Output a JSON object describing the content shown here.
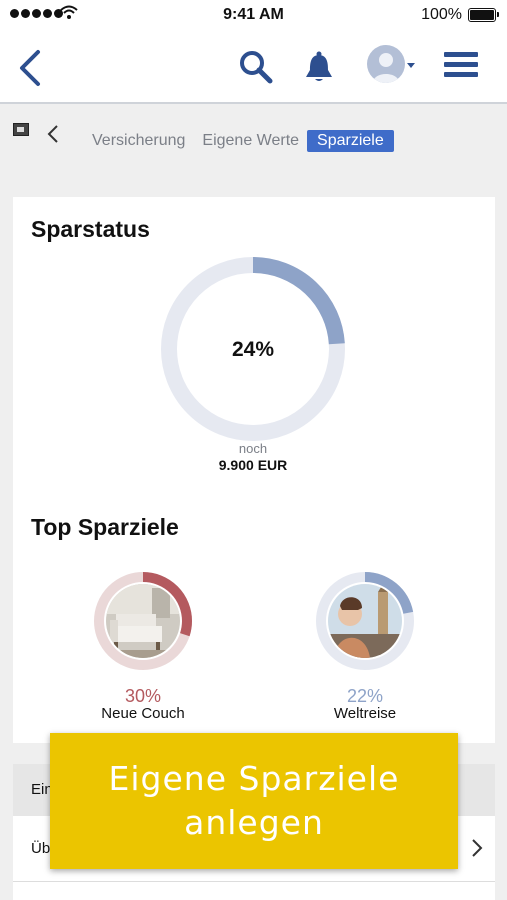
{
  "status_bar": {
    "time": "9:41 AM",
    "battery": "100%"
  },
  "nav": {
    "back_icon": "chevron-left-icon",
    "search_icon": "search-icon",
    "bell_icon": "bell-icon",
    "avatar_icon": "user-avatar",
    "menu_icon": "hamburger-menu-icon",
    "accent": "#2d4f8f"
  },
  "breadcrumb": {
    "tabs": [
      "Versicherung",
      "Eigene Werte",
      "Sparziele"
    ],
    "active_index": 2,
    "active_color": "#3f6cc9"
  },
  "sparstatus": {
    "title": "Sparstatus",
    "percent_label": "24%",
    "progress": 0.24,
    "remaining_label": "noch",
    "remaining_amount": "9.900",
    "currency": "EUR",
    "ring_color": "#8ea3c8",
    "track_color": "#e6e9f1"
  },
  "top_goals": {
    "title": "Top Sparziele",
    "items": [
      {
        "pct_label": "30%",
        "progress": 0.3,
        "name": "Neue Couch",
        "color": "#b45a5f",
        "track": "#ead8d8"
      },
      {
        "pct_label": "22%",
        "progress": 0.22,
        "name": "Weltreise",
        "color": "#8ea3c8",
        "track": "#e6e9f1"
      }
    ]
  },
  "list": {
    "header": "Ein",
    "row1": "Üb"
  },
  "cta": {
    "line1": "Eigene Sparziele",
    "line2": "anlegen",
    "color": "#ebc500"
  }
}
